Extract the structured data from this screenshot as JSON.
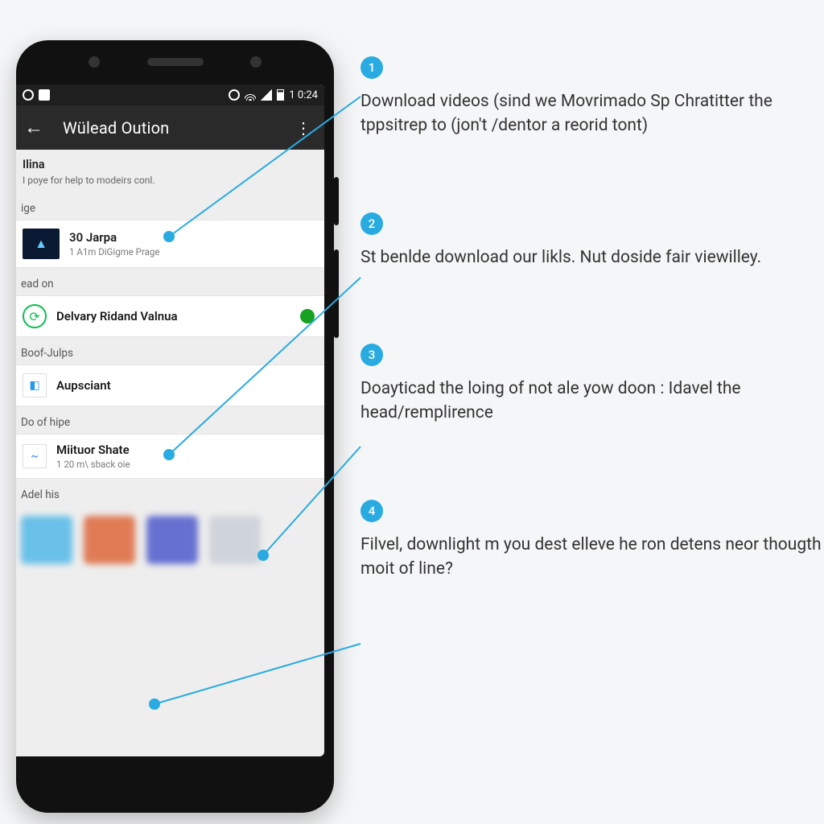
{
  "statusbar": {
    "time": "1 0:24"
  },
  "appbar": {
    "title": "Wülead Oution"
  },
  "section1": {
    "heading": "Ilina",
    "sub": "I poye for help to modeirs conl."
  },
  "sub_ige": "ige",
  "card_jarpa": {
    "name": "30 Jarpa",
    "meta": "1 A1m DiGigme Prage"
  },
  "sub_ead": "ead on",
  "card_delvary": {
    "name": "Delvary Ridand Valnua"
  },
  "sub_boof": "Boof-Julps",
  "card_aups": {
    "name": "Aupsciant"
  },
  "sub_dohipe": "Do of hipe",
  "card_miituor": {
    "name": "Miituor Shate",
    "meta": "1 20 m\\ sback oie"
  },
  "sub_adel": "Adel his",
  "steps": {
    "s1": {
      "n": "1",
      "text": "Download videos (sind we Movrimado Sp Chratitter the tppsitrep to (jon't /dentor a reorid tont)"
    },
    "s2": {
      "n": "2",
      "text": "St benlde download our likls. Nut doside fair viewilley."
    },
    "s3": {
      "n": "3",
      "text": "Doayticad the loing of not ale yow doon : Idavel the head/remplirence"
    },
    "s4": {
      "n": "4",
      "text": "Filvel, downlight m you dest elleve he ron detens neor thougth moit of line?"
    }
  }
}
